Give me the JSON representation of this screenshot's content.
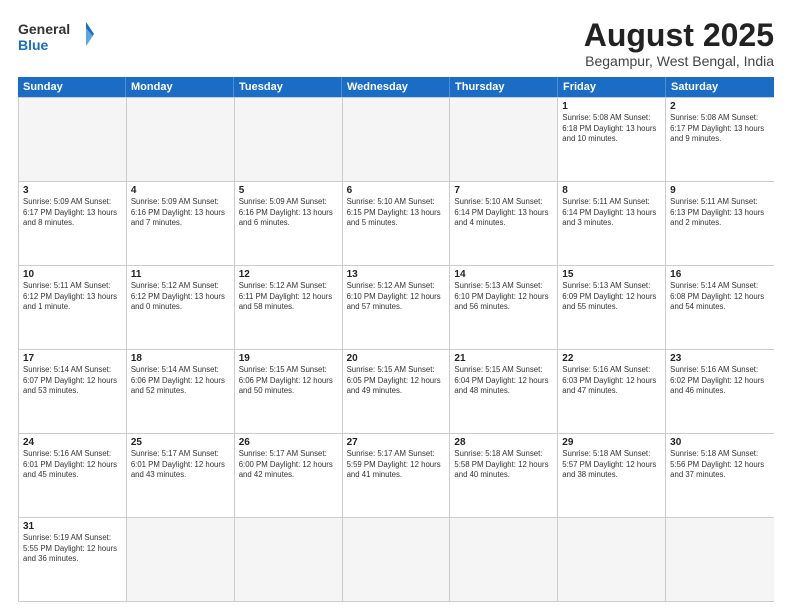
{
  "header": {
    "logo_general": "General",
    "logo_blue": "Blue",
    "title": "August 2025",
    "subtitle": "Begampur, West Bengal, India"
  },
  "weekdays": [
    "Sunday",
    "Monday",
    "Tuesday",
    "Wednesday",
    "Thursday",
    "Friday",
    "Saturday"
  ],
  "rows": [
    [
      {
        "day": "",
        "info": ""
      },
      {
        "day": "",
        "info": ""
      },
      {
        "day": "",
        "info": ""
      },
      {
        "day": "",
        "info": ""
      },
      {
        "day": "",
        "info": ""
      },
      {
        "day": "1",
        "info": "Sunrise: 5:08 AM\nSunset: 6:18 PM\nDaylight: 13 hours and 10 minutes."
      },
      {
        "day": "2",
        "info": "Sunrise: 5:08 AM\nSunset: 6:17 PM\nDaylight: 13 hours and 9 minutes."
      }
    ],
    [
      {
        "day": "3",
        "info": "Sunrise: 5:09 AM\nSunset: 6:17 PM\nDaylight: 13 hours and 8 minutes."
      },
      {
        "day": "4",
        "info": "Sunrise: 5:09 AM\nSunset: 6:16 PM\nDaylight: 13 hours and 7 minutes."
      },
      {
        "day": "5",
        "info": "Sunrise: 5:09 AM\nSunset: 6:16 PM\nDaylight: 13 hours and 6 minutes."
      },
      {
        "day": "6",
        "info": "Sunrise: 5:10 AM\nSunset: 6:15 PM\nDaylight: 13 hours and 5 minutes."
      },
      {
        "day": "7",
        "info": "Sunrise: 5:10 AM\nSunset: 6:14 PM\nDaylight: 13 hours and 4 minutes."
      },
      {
        "day": "8",
        "info": "Sunrise: 5:11 AM\nSunset: 6:14 PM\nDaylight: 13 hours and 3 minutes."
      },
      {
        "day": "9",
        "info": "Sunrise: 5:11 AM\nSunset: 6:13 PM\nDaylight: 13 hours and 2 minutes."
      }
    ],
    [
      {
        "day": "10",
        "info": "Sunrise: 5:11 AM\nSunset: 6:12 PM\nDaylight: 13 hours and 1 minute."
      },
      {
        "day": "11",
        "info": "Sunrise: 5:12 AM\nSunset: 6:12 PM\nDaylight: 13 hours and 0 minutes."
      },
      {
        "day": "12",
        "info": "Sunrise: 5:12 AM\nSunset: 6:11 PM\nDaylight: 12 hours and 58 minutes."
      },
      {
        "day": "13",
        "info": "Sunrise: 5:12 AM\nSunset: 6:10 PM\nDaylight: 12 hours and 57 minutes."
      },
      {
        "day": "14",
        "info": "Sunrise: 5:13 AM\nSunset: 6:10 PM\nDaylight: 12 hours and 56 minutes."
      },
      {
        "day": "15",
        "info": "Sunrise: 5:13 AM\nSunset: 6:09 PM\nDaylight: 12 hours and 55 minutes."
      },
      {
        "day": "16",
        "info": "Sunrise: 5:14 AM\nSunset: 6:08 PM\nDaylight: 12 hours and 54 minutes."
      }
    ],
    [
      {
        "day": "17",
        "info": "Sunrise: 5:14 AM\nSunset: 6:07 PM\nDaylight: 12 hours and 53 minutes."
      },
      {
        "day": "18",
        "info": "Sunrise: 5:14 AM\nSunset: 6:06 PM\nDaylight: 12 hours and 52 minutes."
      },
      {
        "day": "19",
        "info": "Sunrise: 5:15 AM\nSunset: 6:06 PM\nDaylight: 12 hours and 50 minutes."
      },
      {
        "day": "20",
        "info": "Sunrise: 5:15 AM\nSunset: 6:05 PM\nDaylight: 12 hours and 49 minutes."
      },
      {
        "day": "21",
        "info": "Sunrise: 5:15 AM\nSunset: 6:04 PM\nDaylight: 12 hours and 48 minutes."
      },
      {
        "day": "22",
        "info": "Sunrise: 5:16 AM\nSunset: 6:03 PM\nDaylight: 12 hours and 47 minutes."
      },
      {
        "day": "23",
        "info": "Sunrise: 5:16 AM\nSunset: 6:02 PM\nDaylight: 12 hours and 46 minutes."
      }
    ],
    [
      {
        "day": "24",
        "info": "Sunrise: 5:16 AM\nSunset: 6:01 PM\nDaylight: 12 hours and 45 minutes."
      },
      {
        "day": "25",
        "info": "Sunrise: 5:17 AM\nSunset: 6:01 PM\nDaylight: 12 hours and 43 minutes."
      },
      {
        "day": "26",
        "info": "Sunrise: 5:17 AM\nSunset: 6:00 PM\nDaylight: 12 hours and 42 minutes."
      },
      {
        "day": "27",
        "info": "Sunrise: 5:17 AM\nSunset: 5:59 PM\nDaylight: 12 hours and 41 minutes."
      },
      {
        "day": "28",
        "info": "Sunrise: 5:18 AM\nSunset: 5:58 PM\nDaylight: 12 hours and 40 minutes."
      },
      {
        "day": "29",
        "info": "Sunrise: 5:18 AM\nSunset: 5:57 PM\nDaylight: 12 hours and 38 minutes."
      },
      {
        "day": "30",
        "info": "Sunrise: 5:18 AM\nSunset: 5:56 PM\nDaylight: 12 hours and 37 minutes."
      }
    ],
    [
      {
        "day": "31",
        "info": "Sunrise: 5:19 AM\nSunset: 5:55 PM\nDaylight: 12 hours and 36 minutes."
      },
      {
        "day": "",
        "info": ""
      },
      {
        "day": "",
        "info": ""
      },
      {
        "day": "",
        "info": ""
      },
      {
        "day": "",
        "info": ""
      },
      {
        "day": "",
        "info": ""
      },
      {
        "day": "",
        "info": ""
      }
    ]
  ]
}
